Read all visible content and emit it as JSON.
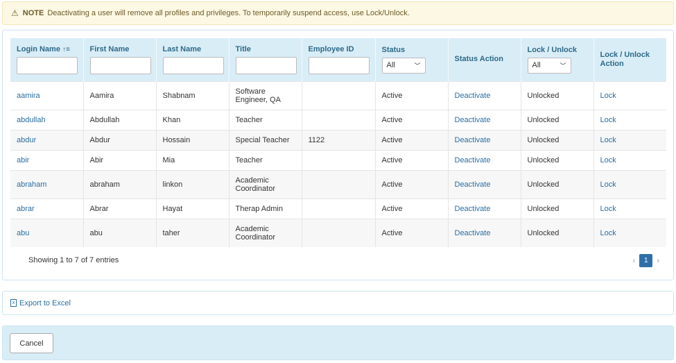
{
  "note": {
    "label": "NOTE",
    "text": "Deactivating a user will remove all profiles and privileges. To temporarily suspend access, use Lock/Unlock."
  },
  "table": {
    "columns": {
      "login_name": "Login Name",
      "first_name": "First Name",
      "last_name": "Last Name",
      "title": "Title",
      "employee_id": "Employee ID",
      "status": "Status",
      "status_action": "Status Action",
      "lock_unlock": "Lock / Unlock",
      "lock_unlock_action": "Lock / Unlock Action"
    },
    "filters": {
      "status_selected": "All",
      "lock_selected": "All"
    },
    "rows": [
      {
        "login": "aamira",
        "first": "Aamira",
        "last": "Shabnam",
        "title": "Software Engineer, QA",
        "employee_id": "",
        "status": "Active",
        "status_action": "Deactivate",
        "lock_state": "Unlocked",
        "lock_action": "Lock"
      },
      {
        "login": "abdullah",
        "first": "Abdullah",
        "last": "Khan",
        "title": "Teacher",
        "employee_id": "",
        "status": "Active",
        "status_action": "Deactivate",
        "lock_state": "Unlocked",
        "lock_action": "Lock"
      },
      {
        "login": "abdur",
        "first": "Abdur",
        "last": "Hossain",
        "title": "Special Teacher",
        "employee_id": "1122",
        "status": "Active",
        "status_action": "Deactivate",
        "lock_state": "Unlocked",
        "lock_action": "Lock"
      },
      {
        "login": "abir",
        "first": "Abir",
        "last": "Mia",
        "title": "Teacher",
        "employee_id": "",
        "status": "Active",
        "status_action": "Deactivate",
        "lock_state": "Unlocked",
        "lock_action": "Lock"
      },
      {
        "login": "abraham",
        "first": "abraham",
        "last": "linkon",
        "title": "Academic Coordinator",
        "employee_id": "",
        "status": "Active",
        "status_action": "Deactivate",
        "lock_state": "Unlocked",
        "lock_action": "Lock"
      },
      {
        "login": "abrar",
        "first": "Abrar",
        "last": "Hayat",
        "title": "Therap Admin",
        "employee_id": "",
        "status": "Active",
        "status_action": "Deactivate",
        "lock_state": "Unlocked",
        "lock_action": "Lock"
      },
      {
        "login": "abu",
        "first": "abu",
        "last": "taher",
        "title": "Academic Coordinator",
        "employee_id": "",
        "status": "Active",
        "status_action": "Deactivate",
        "lock_state": "Unlocked",
        "lock_action": "Lock"
      }
    ],
    "showing": "Showing 1 to 7 of 7 entries",
    "pagination": {
      "prev": "‹",
      "current_page": "1",
      "next": "›"
    }
  },
  "export": {
    "label": "Export to Excel"
  },
  "footer": {
    "cancel_label": "Cancel"
  },
  "icons": {
    "note": "warning-icon",
    "sort": "sort-ascending-icon",
    "dropdown": "chevron-down-icon",
    "export": "excel-file-icon"
  },
  "colors": {
    "header_bg": "#d9edf7",
    "header_text": "#2d6987",
    "link": "#2a6ea0",
    "note_bg": "#fcf8e3",
    "page_active": "#2f6fa7"
  }
}
